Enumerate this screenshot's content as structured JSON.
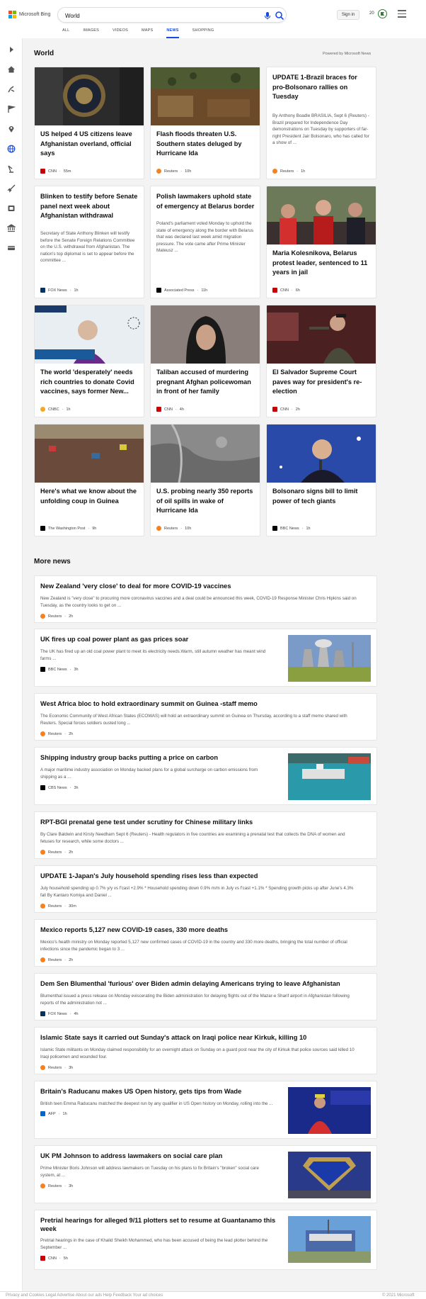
{
  "header": {
    "logo_text": "Microsoft Bing",
    "search_value": "World",
    "signin_label": "Sign in",
    "points": "20",
    "tabs": [
      {
        "label": "ALL"
      },
      {
        "label": "IMAGES"
      },
      {
        "label": "VIDEOS"
      },
      {
        "label": "MAPS"
      },
      {
        "label": "NEWS"
      },
      {
        "label": "SHOPPING"
      }
    ],
    "active_tab": "NEWS",
    "accent_color": "#174ae4"
  },
  "sidebar": {
    "icons": [
      "expand-icon",
      "home-icon",
      "sports-icon",
      "flag-icon",
      "location-icon",
      "globe-icon",
      "science-icon",
      "rocket-icon",
      "entertainment-icon",
      "politics-icon",
      "money-icon"
    ]
  },
  "world": {
    "title": "World",
    "powered_by": "Powered by Microsoft News",
    "cards": [
      {
        "title": "US helped 4 US citizens leave Afghanistan overland, official says",
        "desc": "",
        "source": "CNN",
        "time": "55m",
        "src_color": "#cc0000",
        "image": "seal-image"
      },
      {
        "title": "Flash floods threaten U.S. Southern states deluged by Hurricane Ida",
        "desc": "",
        "source": "Reuters",
        "time": "10h",
        "src_color": "#f58220",
        "image": "flood-image"
      },
      {
        "title": "UPDATE 1-Brazil braces for pro-Bolsonaro rallies on Tuesday",
        "desc": "By Anthony Boadle BRASILIA, Sept 6 (Reuters) - Brazil prepared for Independence Day demonstrations on Tuesday by supporters of far-right President Jair Bolsonaro, who has called for a show of ...",
        "source": "Reuters",
        "time": "1h",
        "src_color": "#f58220",
        "image": ""
      },
      {
        "title": "Blinken to testify before Senate panel next week about Afghanistan withdrawal",
        "desc": "Secretary of State Anthony Blinken will testify before the Senate Foreign Relations Committee on the U.S. withdrawal from Afghanistan. The nation's top diplomat is set to appear before the committee ...",
        "source": "FOX News",
        "time": "1h",
        "src_color": "#003366",
        "image": ""
      },
      {
        "title": "Polish lawmakers uphold state of emergency at Belarus border",
        "desc": "Poland's parliament voted Monday to uphold the state of emergency along the border with Belarus that was declared last week amid migration pressure. The vote came after Prime Minister Mateusz ...",
        "source": "Associated Press",
        "time": "11h",
        "src_color": "#000000",
        "image": ""
      },
      {
        "title": "Maria Kolesnikova, Belarus protest leader, sentenced to 11 years in jail",
        "desc": "",
        "source": "CNN",
        "time": "6h",
        "src_color": "#cc0000",
        "image": "protest-image"
      },
      {
        "title": "The world 'desperately' needs rich countries to donate Covid vaccines, says former New...",
        "desc": "",
        "source": "CNBC",
        "time": "1h",
        "src_color": "#f5a623",
        "image": "helen-clark-image"
      },
      {
        "title": "Taliban accused of murdering pregnant Afghan policewoman in front of her family",
        "desc": "",
        "source": "CNN",
        "time": "4h",
        "src_color": "#cc0000",
        "image": "policewoman-image"
      },
      {
        "title": "El Salvador Supreme Court paves way for president's re-election",
        "desc": "",
        "source": "CNN",
        "time": "2h",
        "src_color": "#cc0000",
        "image": "bukele-image"
      },
      {
        "title": "Here's what we know about the unfolding coup in Guinea",
        "desc": "",
        "source": "The Washington Post",
        "time": "9h",
        "src_color": "#000000",
        "image": "crowd-image"
      },
      {
        "title": "U.S. probing nearly 350 reports of oil spills in wake of Hurricane Ida",
        "desc": "",
        "source": "Reuters",
        "time": "10h",
        "src_color": "#f58220",
        "image": "aerial-image"
      },
      {
        "title": "Bolsonaro signs bill to limit power of tech giants",
        "desc": "",
        "source": "BBC News",
        "time": "1h",
        "src_color": "#000000",
        "image": "bolsonaro-image"
      }
    ]
  },
  "more_news": {
    "title": "More news",
    "items": [
      {
        "title": "New Zealand 'very close' to deal for more COVID-19 vaccines",
        "desc1": "New Zealand is \"very close\" to procuring more coronavirus vaccines and a deal could be announced this week, COVID-19 Response Minister Chris Hipkins said on",
        "desc2": "Tuesday, as the country looks to get on ...",
        "source": "Reuters",
        "time": "2h",
        "src_color": "#f58220",
        "image": ""
      },
      {
        "title": "UK fires up coal power plant as gas prices soar",
        "desc1": "The UK has fired up an old coal power plant to meet its electricity needs.Warm, still autumn weather has meant wind",
        "desc2": "farms ...",
        "source": "BBC News",
        "time": "3h",
        "src_color": "#000000",
        "image": "power-plant-image"
      },
      {
        "title": "West Africa bloc to hold extraordinary summit on Guinea -staff memo",
        "desc1": "The Economic Community of West African States (ECOWAS) will hold an extraordinary summit on Guinea on Thursday, according to a staff memo shared with",
        "desc2": "Reuters. Special forces soldiers ousted long ...",
        "source": "Reuters",
        "time": "2h",
        "src_color": "#f58220",
        "image": ""
      },
      {
        "title": "Shipping industry group backs putting a price on carbon",
        "desc1": "A major maritime industry association on Monday backed plans for a global surcharge on carbon emissions from",
        "desc2": "shipping as a ...",
        "source": "CBS News",
        "time": "3h",
        "src_color": "#000000",
        "image": "port-image"
      },
      {
        "title": "RPT-BGI prenatal gene test under scrutiny for Chinese military links",
        "desc1": "By Clare Baldwin and Kirsty Needham Sept 6 (Reuters) - Health regulators in five countries are examining a prenatal test that collects the DNA of women and",
        "desc2": "fetuses for research, while some doctors ...",
        "source": "Reuters",
        "time": "2h",
        "src_color": "#f58220",
        "image": ""
      },
      {
        "title": "UPDATE 1-Japan's July household spending rises less than expected",
        "desc1": "July household spending up 0.7% y/y vs f'cast +2.9% * Household spending down 0.9% m/m in July vs f'cast +1.1% * Spending growth picks up after June's 4.3%",
        "desc2": "fall By Kantaro Komiya and Daniel ...",
        "source": "Reuters",
        "time": "30m",
        "src_color": "#f58220",
        "image": ""
      },
      {
        "title": "Mexico reports 5,127 new COVID-19 cases, 330 more deaths",
        "desc1": "Mexico's health ministry on Monday reported 5,127 new confirmed cases of COVID-19 in the country and 330 more deaths, bringing the total number of official",
        "desc2": "infections since the pandemic began to 3 ...",
        "source": "Reuters",
        "time": "2h",
        "src_color": "#f58220",
        "image": ""
      },
      {
        "title": "Dem Sen Blumenthal 'furious' over Biden admin delaying Americans trying to leave Afghanistan",
        "desc1": "Blumenthal issued a press release on Monday eviscerating the Biden administration for delaying flights out of the Mazar-e Sharif airport in Afghanistan following",
        "desc2": "reports of the administration not ...",
        "source": "FOX News",
        "time": "4h",
        "src_color": "#003366",
        "image": ""
      },
      {
        "title": "Islamic State says it carried out Sunday's attack on Iraqi police near Kirkuk, killing 10",
        "desc1": "Islamic State militants on Monday claimed responsibility for an overnight attack on Sunday on a guard post near the city of Kirkuk that police sources said killed 10",
        "desc2": "Iraqi policemen and wounded four.",
        "source": "Reuters",
        "time": "3h",
        "src_color": "#f58220",
        "image": ""
      },
      {
        "title": "Britain's Raducanu makes US Open history, gets tips from Wade",
        "desc1": "British teen Emma Raducanu matched the deepest run by any qualifier in US Open history on Monday, rolling into the ...",
        "desc2": "",
        "source": "AFP",
        "time": "1h",
        "src_color": "#0066cc",
        "image": "tennis-image"
      },
      {
        "title": "UK PM Johnson to address lawmakers on social care plan",
        "desc1": "Prime Minister Boris Johnson will address lawmakers on Tuesday on his plans to fix Britain's \"broken\" social care",
        "desc2": "system, at ...",
        "source": "Reuters",
        "time": "3h",
        "src_color": "#f58220",
        "image": "nhs-image"
      },
      {
        "title": "Pretrial hearings for alleged 9/11 plotters set to resume at Guantanamo this week",
        "desc1": "Pretrial hearings in the case of Khalid Sheikh Mohammed, who has been accused of being the lead plotter behind the",
        "desc2": "September ...",
        "source": "CNN",
        "time": "5h",
        "src_color": "#cc0000",
        "image": "guantanamo-image"
      }
    ]
  },
  "footer": {
    "text": "Privacy and Cookies  Legal  Advertise  About our ads  Help  Feedback  Your ad choices",
    "right": "© 2021 Microsoft"
  }
}
